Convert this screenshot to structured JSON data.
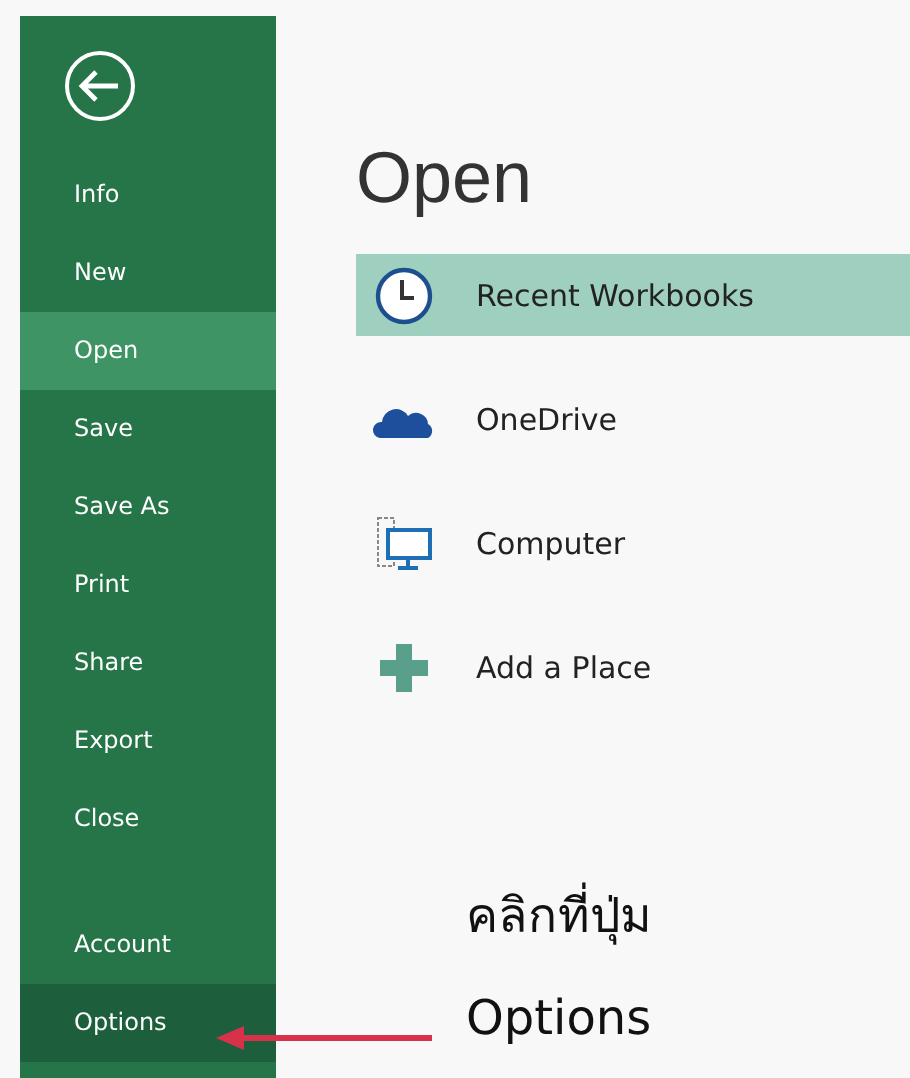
{
  "sidebar": {
    "items": [
      {
        "label": "Info",
        "selected": false,
        "hovered": false
      },
      {
        "label": "New",
        "selected": false,
        "hovered": false
      },
      {
        "label": "Open",
        "selected": true,
        "hovered": false
      },
      {
        "label": "Save",
        "selected": false,
        "hovered": false
      },
      {
        "label": "Save As",
        "selected": false,
        "hovered": false
      },
      {
        "label": "Print",
        "selected": false,
        "hovered": false
      },
      {
        "label": "Share",
        "selected": false,
        "hovered": false
      },
      {
        "label": "Export",
        "selected": false,
        "hovered": false
      },
      {
        "label": "Close",
        "selected": false,
        "hovered": false
      }
    ],
    "bottom_items": [
      {
        "label": "Account",
        "selected": false,
        "hovered": false
      },
      {
        "label": "Options",
        "selected": false,
        "hovered": true
      }
    ]
  },
  "title": "Open",
  "places": [
    {
      "kind": "recent",
      "label": "Recent Workbooks",
      "selected": true
    },
    {
      "kind": "onedrive",
      "label": "OneDrive",
      "selected": false
    },
    {
      "kind": "computer",
      "label": "Computer",
      "selected": false
    },
    {
      "kind": "add",
      "label": "Add a Place",
      "selected": false
    }
  ],
  "annotation": {
    "line_1": "คลิกที่ปุ่ม",
    "line_2": "Options"
  }
}
